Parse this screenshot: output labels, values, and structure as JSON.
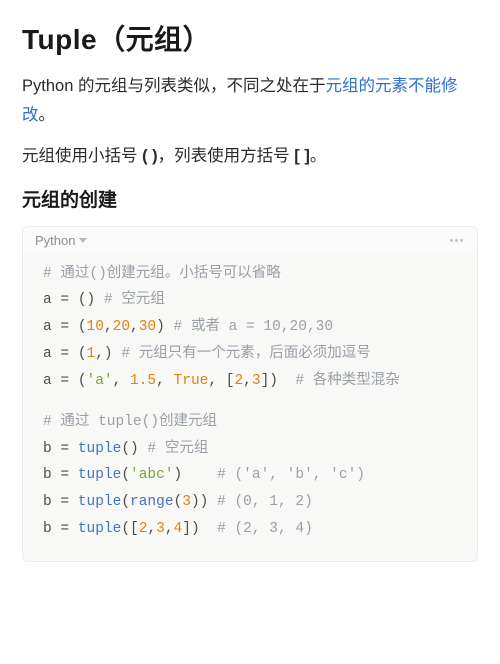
{
  "title": "Tuple（元组）",
  "intro1_prefix": "Python 的元组与列表类似，不同之处在于",
  "intro1_highlight": "元组的元素不能修改",
  "intro1_suffix": "。",
  "intro2_a": "元组使用小括号 ",
  "intro2_b": "( )",
  "intro2_c": "，列表使用方括号 ",
  "intro2_d": "[ ]",
  "intro2_e": "。",
  "section_title": "元组的创建",
  "code": {
    "lang": "Python",
    "c1": "# 通过()创建元组。小括号可以省略",
    "l2": {
      "v": "a",
      "eq": " = ",
      "lp": "(",
      "rp": ")",
      "c": " # 空元组"
    },
    "l3": {
      "v": "a",
      "eq": " = ",
      "lp": "(",
      "n1": "10",
      "cm1": ",",
      "n2": "20",
      "cm2": ",",
      "n3": "30",
      "rp": ")",
      "c": " # 或者 a = 10,20,30"
    },
    "l4": {
      "v": "a",
      "eq": " = ",
      "lp": "(",
      "n1": "1",
      "cm": ",",
      "rp": ")",
      "c": " # 元组只有一个元素，后面必须加逗号"
    },
    "l5": {
      "v": "a",
      "eq": " = ",
      "lp": "(",
      "s": "'a'",
      "cm1": ", ",
      "n": "1.5",
      "cm2": ", ",
      "b": "True",
      "cm3": ", ",
      "lb": "[",
      "n2": "2",
      "cm4": ",",
      "n3": "3",
      "rb": "]",
      "rp": ")",
      "c": "  # 各种类型混杂"
    },
    "c2": "# 通过 tuple()创建元组",
    "l7": {
      "v": "b",
      "eq": " = ",
      "fn": "tuple",
      "lp": "(",
      "rp": ")",
      "c": " # 空元组"
    },
    "l8": {
      "v": "b",
      "eq": " = ",
      "fn": "tuple",
      "lp": "(",
      "s": "'abc'",
      "rp": ")",
      "sp": "    ",
      "c": "# ('a', 'b', 'c')"
    },
    "l9": {
      "v": "b",
      "eq": " = ",
      "fn": "tuple",
      "lp": "(",
      "fn2": "range",
      "lp2": "(",
      "n": "3",
      "rp2": ")",
      "rp": ")",
      "c": " # (0, 1, 2)"
    },
    "l10": {
      "v": "b",
      "eq": " = ",
      "fn": "tuple",
      "lp": "(",
      "lb": "[",
      "n1": "2",
      "cm1": ",",
      "n2": "3",
      "cm2": ",",
      "n3": "4",
      "rb": "]",
      "rp": ")",
      "sp": "  ",
      "c": "# (2, 3, 4)"
    }
  }
}
